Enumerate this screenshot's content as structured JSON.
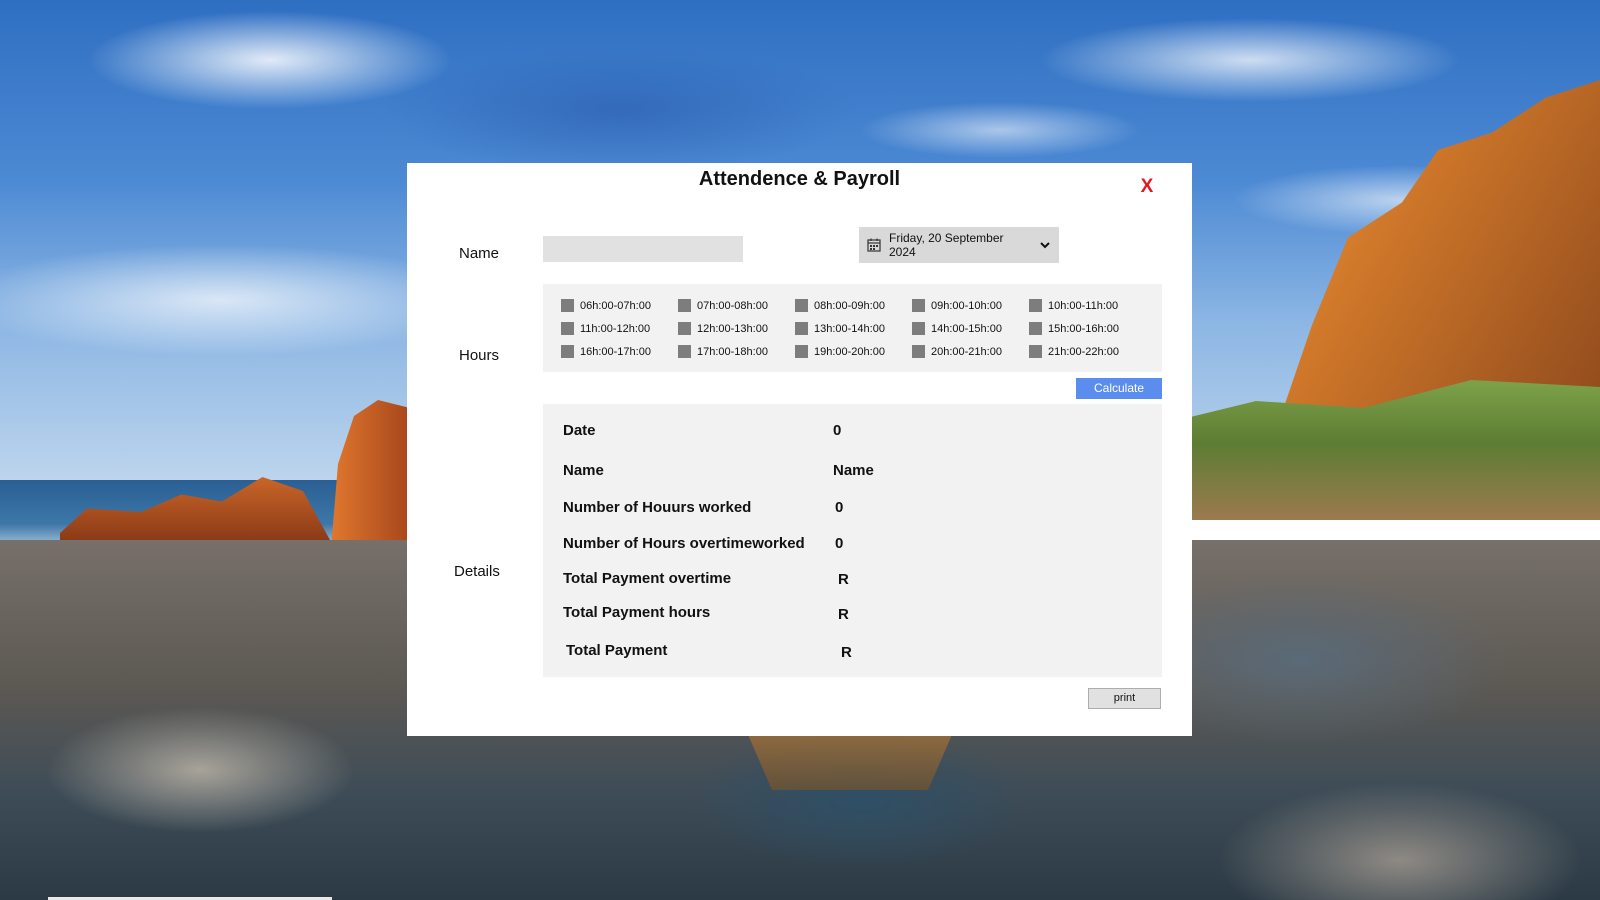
{
  "window": {
    "title": "Attendence & Payroll",
    "close_label": "X"
  },
  "form": {
    "name_label": "Name",
    "name_value": "",
    "date_value": "Friday, 20 September 2024",
    "hours_label": "Hours",
    "details_label": "Details"
  },
  "hours": [
    "06h:00-07h:00",
    "07h:00-08h:00",
    "08h:00-09h:00",
    "09h:00-10h:00",
    "10h:00-11h:00",
    "11h:00-12h:00",
    "12h:00-13h:00",
    "13h:00-14h:00",
    "14h:00-15h:00",
    "15h:00-16h:00",
    "16h:00-17h:00",
    "17h:00-18h:00",
    "19h:00-20h:00",
    "20h:00-21h:00",
    "21h:00-22h:00"
  ],
  "buttons": {
    "calculate": "Calculate",
    "print": "print"
  },
  "details": {
    "date_label": "Date",
    "date_value": "0",
    "name_label": "Name",
    "name_value": "Name",
    "hours_worked_label": "Number of Houurs worked",
    "hours_worked_value": "0",
    "overtime_hours_label": "Number of Hours overtimeworked",
    "overtime_hours_value": "0",
    "overtime_pay_label": "Total Payment overtime",
    "overtime_pay_value": "R",
    "hours_pay_label": "Total Payment hours",
    "hours_pay_value": "R",
    "total_pay_label": "Total Payment",
    "total_pay_value": "R"
  },
  "colors": {
    "accent": "#5b8def",
    "close": "#e0191e",
    "panel": "#f2f2f2"
  }
}
